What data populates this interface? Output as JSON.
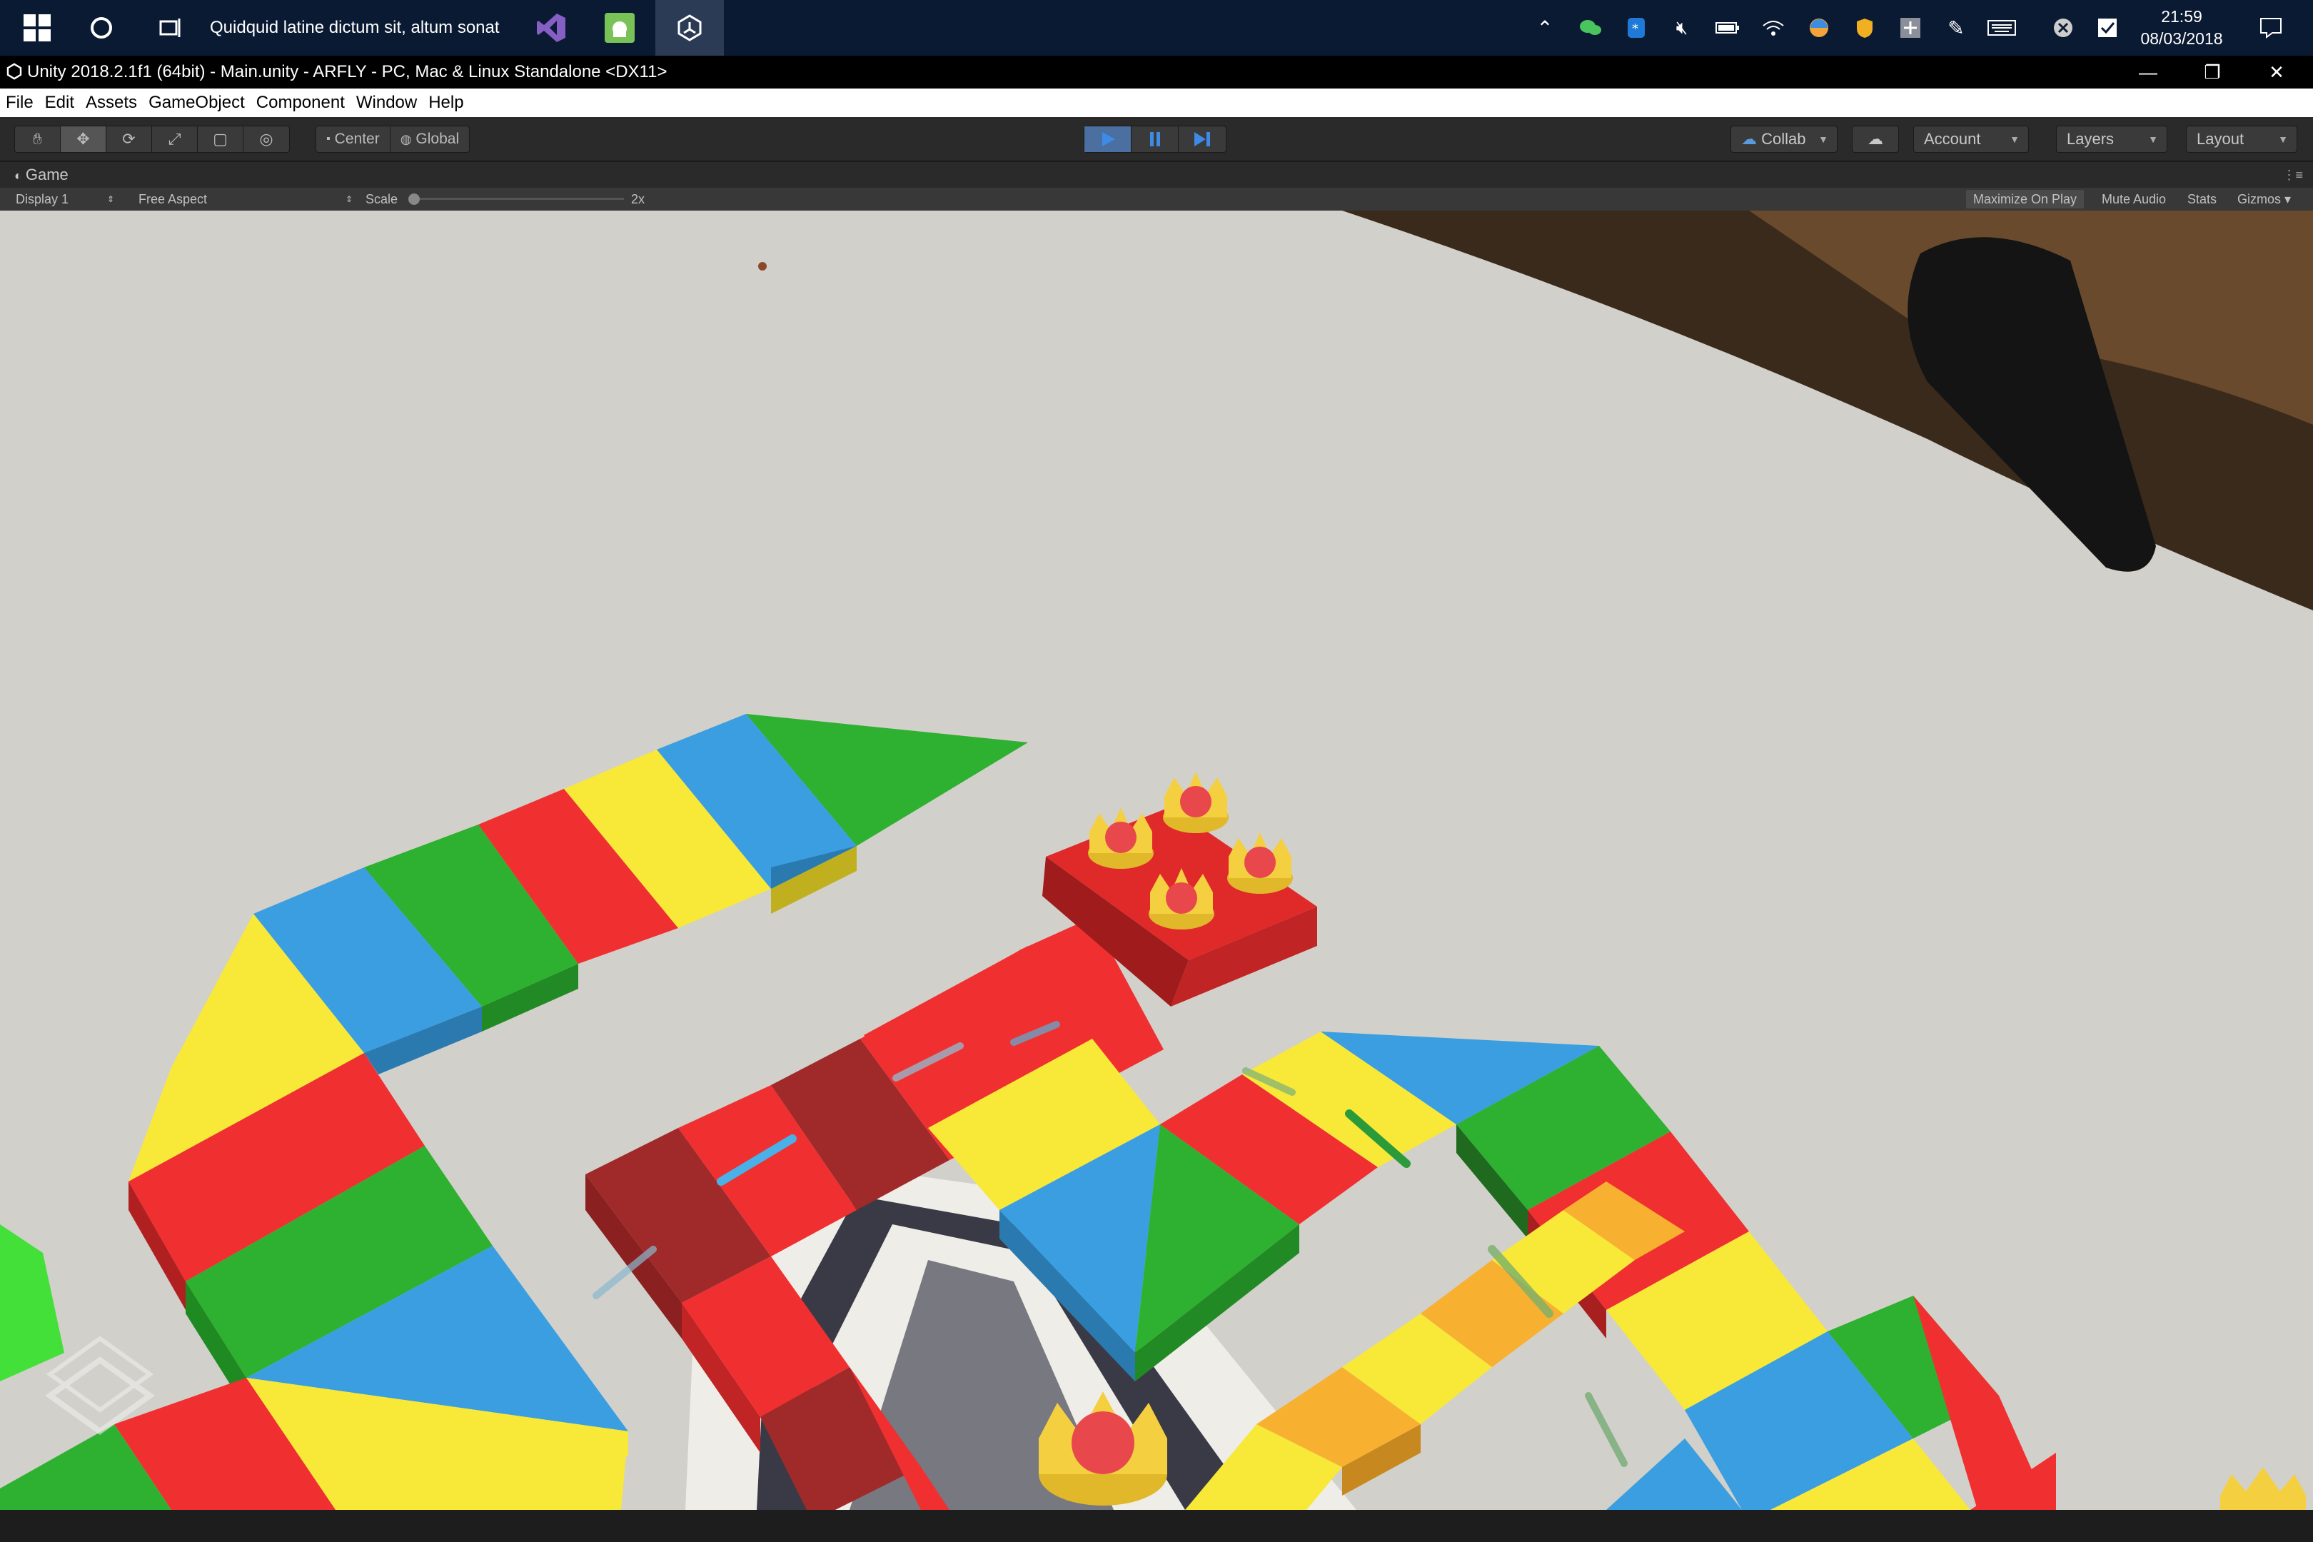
{
  "taskbar": {
    "title": "Quidquid latine dictum sit, altum sonat",
    "clock_time": "21:59",
    "clock_date": "08/03/2018"
  },
  "window": {
    "title": "Unity 2018.2.1f1 (64bit) - Main.unity - ARFLY - PC, Mac & Linux Standalone <DX11>"
  },
  "menu": [
    "File",
    "Edit",
    "Assets",
    "GameObject",
    "Component",
    "Window",
    "Help"
  ],
  "toolbar": {
    "pivot_label": "Center",
    "rotation_label": "Global",
    "collab_label": "Collab",
    "account_label": "Account",
    "layers_label": "Layers",
    "layout_label": "Layout"
  },
  "game": {
    "tab_label": "Game",
    "display": "Display 1",
    "aspect": "Free Aspect",
    "scale_label": "Scale",
    "scale_value": "2x",
    "maximize_on_play": "Maximize On Play",
    "mute_audio": "Mute Audio",
    "stats": "Stats",
    "gizmos": "Gizmos"
  },
  "colors": {
    "board_red": "#f03030",
    "board_yellow": "#f8e838",
    "board_blue": "#3a9ee0",
    "board_green": "#2eb030",
    "board_orange": "#f8b030",
    "table": "#d4d2cc"
  }
}
